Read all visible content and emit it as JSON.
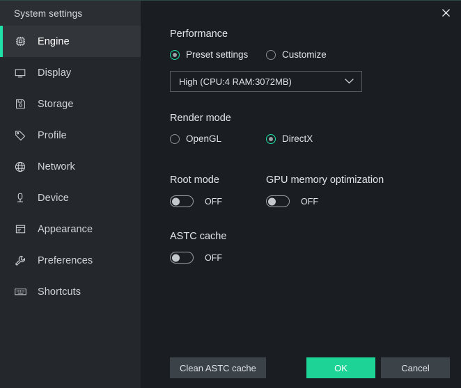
{
  "window": {
    "title": "System settings",
    "close_icon": "close-icon",
    "accent_color": "#1ee0a8",
    "primary_button_color": "#1ed396",
    "sidebar_bg": "#24282c",
    "content_bg": "#1a1e22"
  },
  "sidebar": {
    "items": [
      {
        "label": "Engine",
        "icon": "cpu-chip-icon",
        "active": true
      },
      {
        "label": "Display",
        "icon": "monitor-icon",
        "active": false
      },
      {
        "label": "Storage",
        "icon": "floppy-disk-icon",
        "active": false
      },
      {
        "label": "Profile",
        "icon": "tag-icon",
        "active": false
      },
      {
        "label": "Network",
        "icon": "globe-icon",
        "active": false
      },
      {
        "label": "Device",
        "icon": "device-icon",
        "active": false
      },
      {
        "label": "Appearance",
        "icon": "window-icon",
        "active": false
      },
      {
        "label": "Preferences",
        "icon": "wrench-icon",
        "active": false
      },
      {
        "label": "Shortcuts",
        "icon": "keyboard-icon",
        "active": false
      }
    ]
  },
  "main": {
    "performance": {
      "title": "Performance",
      "options": [
        {
          "label": "Preset settings",
          "selected": true
        },
        {
          "label": "Customize",
          "selected": false
        }
      ],
      "preset_value": "High (CPU:4 RAM:3072MB)",
      "dropdown_icon": "chevron-down-icon"
    },
    "render_mode": {
      "title": "Render mode",
      "options": [
        {
          "label": "OpenGL",
          "selected": false
        },
        {
          "label": "DirectX",
          "selected": true
        }
      ]
    },
    "root_mode": {
      "title": "Root mode",
      "state": "OFF",
      "on": false
    },
    "gpu_memory_optimization": {
      "title": "GPU memory optimization",
      "state": "OFF",
      "on": false
    },
    "astc_cache": {
      "title": "ASTC cache",
      "state": "OFF",
      "on": false
    }
  },
  "footer": {
    "clean_label": "Clean ASTC cache",
    "ok_label": "OK",
    "cancel_label": "Cancel"
  }
}
